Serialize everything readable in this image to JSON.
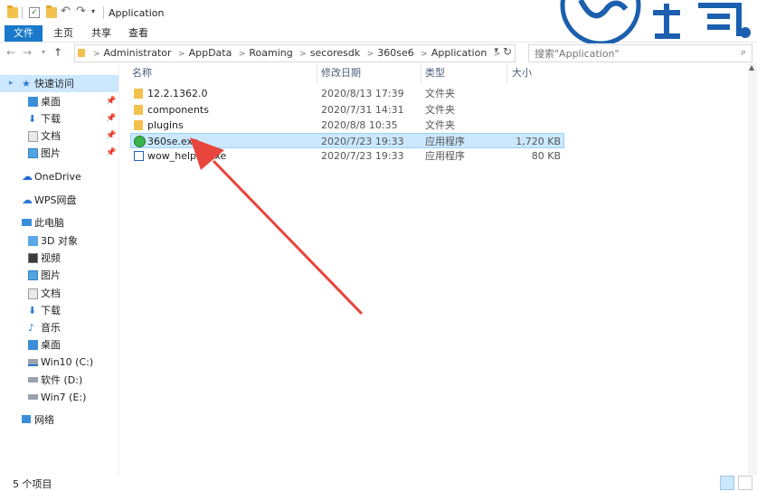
{
  "window": {
    "title": "Application"
  },
  "ribbon": {
    "tabs": [
      "文件",
      "主页",
      "共享",
      "查看"
    ]
  },
  "address": {
    "crumbs": [
      "Administrator",
      "AppData",
      "Roaming",
      "secoresdk",
      "360se6",
      "Application"
    ]
  },
  "search": {
    "placeholder": "搜索\"Application\""
  },
  "nav": {
    "quick_access": "快速访问",
    "quick_items": [
      "桌面",
      "下载",
      "文档",
      "图片"
    ],
    "onedrive": "OneDrive",
    "wps": "WPS网盘",
    "this_pc": "此电脑",
    "pc_items": [
      "3D 对象",
      "视频",
      "图片",
      "文档",
      "下载",
      "音乐",
      "桌面"
    ],
    "drives": [
      "Win10 (C:)",
      "软件 (D:)",
      "Win7 (E:)"
    ],
    "network": "网络"
  },
  "columns": {
    "name": "名称",
    "modified": "修改日期",
    "type": "类型",
    "size": "大小"
  },
  "files": [
    {
      "name": "12.2.1362.0",
      "modified": "2020/8/13 17:39",
      "type": "文件夹",
      "size": "",
      "icon": "folder-icon"
    },
    {
      "name": "components",
      "modified": "2020/7/31 14:31",
      "type": "文件夹",
      "size": "",
      "icon": "folder-icon"
    },
    {
      "name": "plugins",
      "modified": "2020/8/8 10:35",
      "type": "文件夹",
      "size": "",
      "icon": "folder-icon"
    },
    {
      "name": "360se.exe",
      "modified": "2020/7/23 19:33",
      "type": "应用程序",
      "size": "1,720 KB",
      "icon": "browser-360-icon",
      "selected": true
    },
    {
      "name": "wow_helper.exe",
      "modified": "2020/7/23 19:33",
      "type": "应用程序",
      "size": "80 KB",
      "icon": "exe-icon"
    }
  ],
  "status": {
    "item_count": "5 个项目"
  },
  "annotation": {
    "color": "#e8453c",
    "icon": "red-arrow-pointer"
  },
  "colors": {
    "accent": "#1979ca",
    "selection": "#cce8ff"
  }
}
